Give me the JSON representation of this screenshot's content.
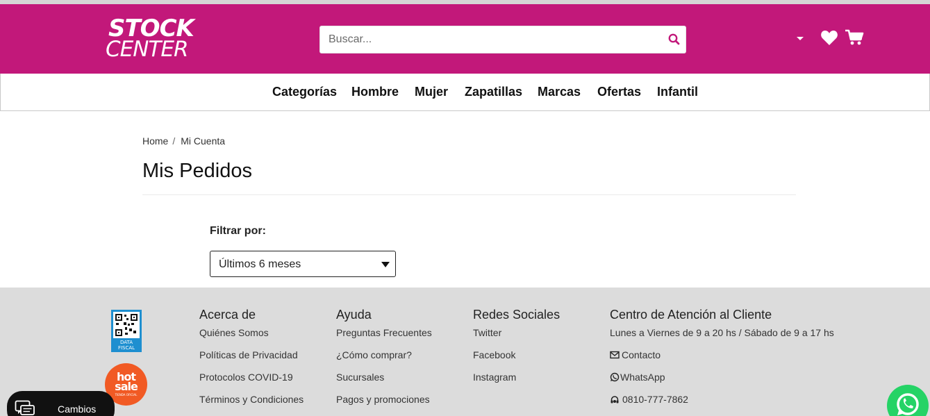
{
  "header": {
    "logo_line1": "STOCK",
    "logo_line2": "CENTER",
    "search_placeholder": "Buscar...",
    "brand_color": "#c2187a",
    "icons": [
      "chevron-down-icon",
      "heart-icon",
      "cart-icon",
      "search-icon"
    ]
  },
  "nav": {
    "items": [
      "Categorías",
      "Hombre",
      "Mujer",
      "Zapatillas",
      "Marcas",
      "Ofertas",
      "Infantil"
    ]
  },
  "breadcrumb": {
    "home": "Home",
    "separator": "/",
    "current": "Mi Cuenta"
  },
  "page": {
    "title": "Mis Pedidos",
    "filter_label": "Filtrar por:",
    "filter_value": "Últimos 6 meses"
  },
  "footer": {
    "badges": {
      "qr_text": "DATA FISCAL",
      "hotsale_line1": "hot",
      "hotsale_line2": "sale",
      "hotsale_line3": "TIENDA OFICIAL"
    },
    "acerca": {
      "title": "Acerca de",
      "links": [
        "Quiénes Somos",
        "Políticas de Privacidad",
        "Protocolos COVID-19",
        "Términos y Condiciones"
      ]
    },
    "ayuda": {
      "title": "Ayuda",
      "links": [
        "Preguntas Frecuentes",
        "¿Cómo comprar?",
        "Sucursales",
        "Pagos y promociones"
      ]
    },
    "redes": {
      "title": "Redes Sociales",
      "links": [
        "Twitter",
        "Facebook",
        "Instagram"
      ]
    },
    "atencion": {
      "title": "Centro de Atención al Cliente",
      "hours": "Lunes a Viernes de 9 a 20 hs / Sábado de 9 a 17 hs",
      "contacto": "Contacto",
      "whatsapp": "WhatsApp",
      "phone": "0810-777-7862"
    }
  },
  "floating": {
    "cambios_label": "Cambios",
    "whatsapp_color": "#25d366"
  }
}
